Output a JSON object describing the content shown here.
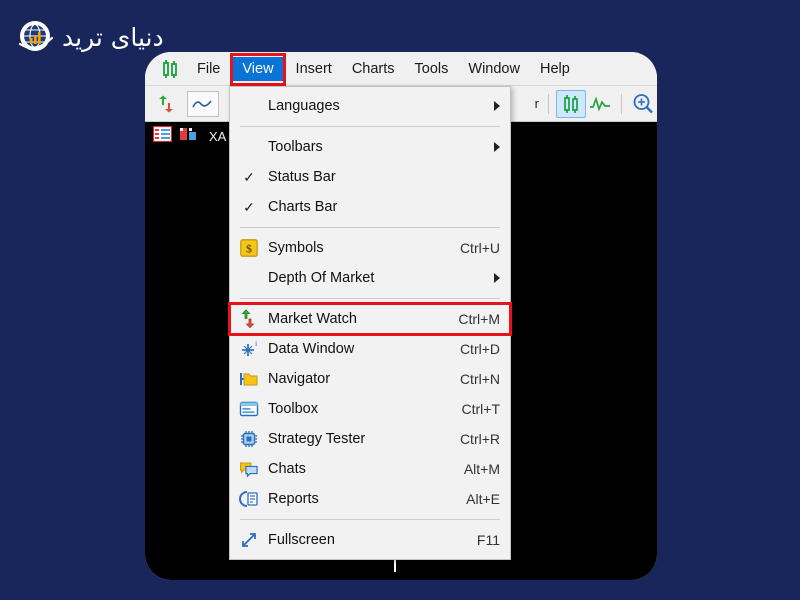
{
  "brand": {
    "name": "brand-logo",
    "text": "دنیای ترید",
    "icon": "globe-icon",
    "colors": {
      "accent": "#f0a500",
      "text": "#ffffff",
      "background": "#18265c"
    }
  },
  "app": {
    "background": "#18265c",
    "card_background": "#ffffff",
    "chart_background": "#000000",
    "highlight_border": "#e8121a",
    "menu_active_background": "#0a73d6"
  },
  "menu_bar": {
    "logo_icon": "metatrader-candles-icon",
    "items": [
      {
        "label": "File",
        "active": false
      },
      {
        "label": "View",
        "active": true
      },
      {
        "label": "Insert",
        "active": false
      },
      {
        "label": "Charts",
        "active": false
      },
      {
        "label": "Tools",
        "active": false
      },
      {
        "label": "Window",
        "active": false
      },
      {
        "label": "Help",
        "active": false
      }
    ]
  },
  "tool_bar": {
    "new_order_icon": "new-order-arrows-icon",
    "line_chart_icon": "line-chart-icon",
    "period_label": "r",
    "candlestick_icon": "candlestick-chart-icon",
    "tick_chart_icon": "tick-chart-icon",
    "zoom_in_icon": "zoom-in-icon"
  },
  "charts_bar": {
    "list_icon": "chart-list-icon",
    "symbol_icon": "symbol-bars-icon",
    "symbol_label": "XA"
  },
  "view_menu": {
    "name": "view-dropdown",
    "groups": [
      {
        "items": [
          {
            "label": "Languages",
            "icon": null,
            "accel": "",
            "submenu": true,
            "checked": false,
            "highlighted": false
          }
        ]
      },
      {
        "items": [
          {
            "label": "Toolbars",
            "icon": null,
            "accel": "",
            "submenu": true,
            "checked": false,
            "highlighted": false
          },
          {
            "label": "Status Bar",
            "icon": null,
            "accel": "",
            "submenu": false,
            "checked": true,
            "highlighted": false
          },
          {
            "label": "Charts Bar",
            "icon": null,
            "accel": "",
            "submenu": false,
            "checked": true,
            "highlighted": false
          }
        ]
      },
      {
        "items": [
          {
            "label": "Symbols",
            "icon": "symbols-dollar-icon",
            "accel": "Ctrl+U",
            "submenu": false,
            "checked": false,
            "highlighted": false
          },
          {
            "label": "Depth Of Market",
            "icon": null,
            "accel": "",
            "submenu": true,
            "checked": false,
            "highlighted": false
          }
        ]
      },
      {
        "items": [
          {
            "label": "Market Watch",
            "icon": "market-watch-arrows-icon",
            "accel": "Ctrl+M",
            "submenu": false,
            "checked": false,
            "highlighted": true
          },
          {
            "label": "Data Window",
            "icon": "data-window-crosshair-icon",
            "accel": "Ctrl+D",
            "submenu": false,
            "checked": false,
            "highlighted": false
          },
          {
            "label": "Navigator",
            "icon": "navigator-folder-icon",
            "accel": "Ctrl+N",
            "submenu": false,
            "checked": false,
            "highlighted": false
          },
          {
            "label": "Toolbox",
            "icon": "toolbox-panel-icon",
            "accel": "Ctrl+T",
            "submenu": false,
            "checked": false,
            "highlighted": false
          },
          {
            "label": "Strategy Tester",
            "icon": "strategy-tester-chip-icon",
            "accel": "Ctrl+R",
            "submenu": false,
            "checked": false,
            "highlighted": false
          },
          {
            "label": "Chats",
            "icon": "chats-bubbles-icon",
            "accel": "Alt+M",
            "submenu": false,
            "checked": false,
            "highlighted": false
          },
          {
            "label": "Reports",
            "icon": "reports-icon",
            "accel": "Alt+E",
            "submenu": false,
            "checked": false,
            "highlighted": false
          }
        ]
      },
      {
        "items": [
          {
            "label": "Fullscreen",
            "icon": "fullscreen-arrows-icon",
            "accel": "F11",
            "submenu": false,
            "checked": false,
            "highlighted": false
          }
        ]
      }
    ]
  }
}
